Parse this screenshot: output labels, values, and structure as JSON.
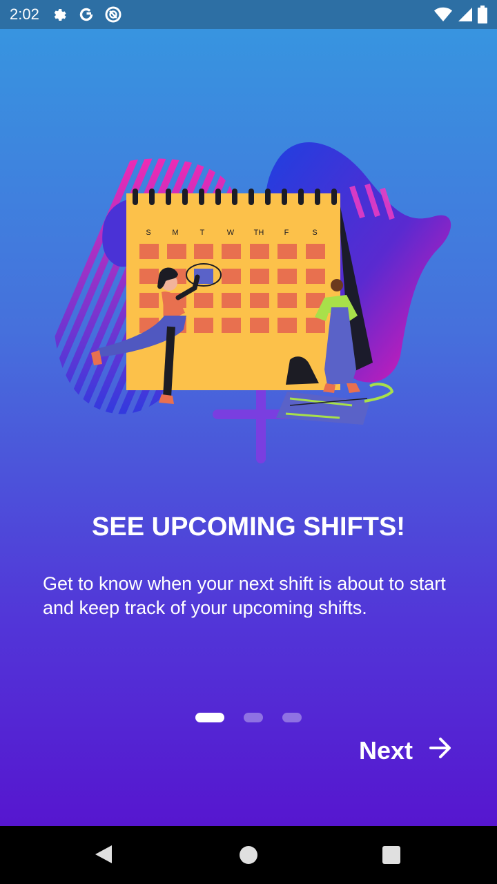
{
  "status_bar": {
    "time": "2:02",
    "icons_left": [
      "settings-gear",
      "google-g",
      "data-saver"
    ],
    "icons_right": [
      "wifi",
      "cellular-signal",
      "battery"
    ]
  },
  "onboarding": {
    "title": "SEE UPCOMING SHIFTS!",
    "description": "Get to know when your next shift is about to start and keep track of your upcoming shifts.",
    "page_indicator": {
      "total": 3,
      "active": 1
    },
    "next_label": "Next"
  },
  "illustration": {
    "calendar_days": [
      "S",
      "M",
      "T",
      "W",
      "TH",
      "F",
      "S"
    ]
  },
  "colors": {
    "gradient_top": "#3698e0",
    "gradient_bottom": "#5616cf",
    "calendar": "#fcc14a",
    "calendar_cell": "#e8704f",
    "blob": "#2b3bd8",
    "accent_pink": "#e832b8"
  },
  "nav_bar": {
    "buttons": [
      "back",
      "home",
      "recents"
    ]
  }
}
